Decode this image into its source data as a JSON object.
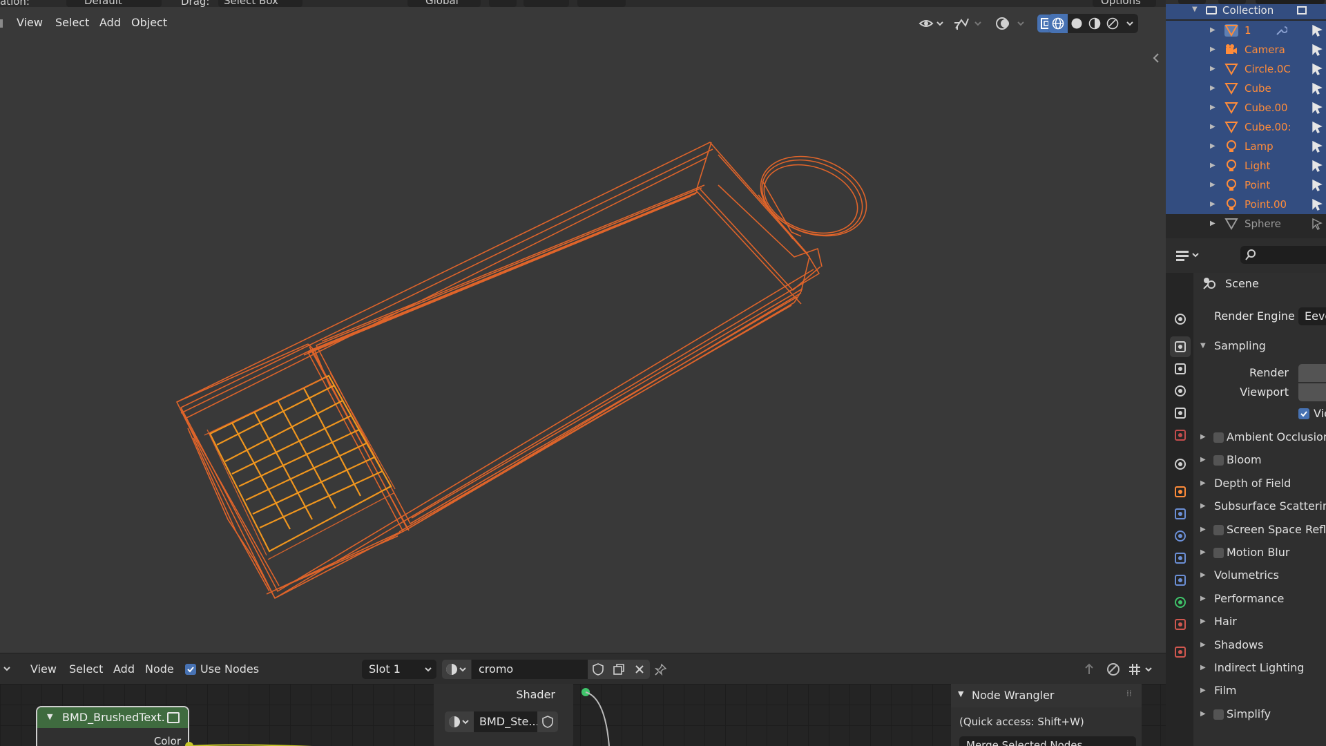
{
  "top_header": {
    "orientation_label": "ation:",
    "orientation_value": "Default",
    "drag_label": "Drag:",
    "drag_value": "Select Box",
    "transform_orientation": "Global",
    "options_label": "Options"
  },
  "viewport": {
    "menu": [
      "View",
      "Select",
      "Add",
      "Object"
    ],
    "wire_color": "#e8672a",
    "header_bg": "#393939"
  },
  "outliner": {
    "collection_label": "Collection",
    "items": [
      {
        "label": "1",
        "type": "mesh",
        "selected": true,
        "active": true
      },
      {
        "label": "Camera",
        "type": "camera",
        "selected": true
      },
      {
        "label": "Circle.0C",
        "type": "mesh",
        "selected": true
      },
      {
        "label": "Cube",
        "type": "mesh",
        "selected": true
      },
      {
        "label": "Cube.00",
        "type": "mesh",
        "selected": true
      },
      {
        "label": "Cube.00:",
        "type": "mesh",
        "selected": true
      },
      {
        "label": "Lamp",
        "type": "light",
        "selected": true
      },
      {
        "label": "Light",
        "type": "light",
        "selected": true
      },
      {
        "label": "Point",
        "type": "light",
        "selected": true
      },
      {
        "label": "Point.00",
        "type": "light",
        "selected": true
      },
      {
        "label": "Sphere",
        "type": "mesh",
        "selected": false
      }
    ],
    "selection_color": "#334d80",
    "selected_text_color": "#ff8c3a"
  },
  "properties": {
    "scene_label": "Scene",
    "render_engine_label": "Render Engine",
    "render_engine_value": "Eeve",
    "sampling": {
      "label": "Sampling",
      "render_label": "Render",
      "viewport_label": "Viewport",
      "viewport_denoise_label": "Vie"
    },
    "panels": [
      {
        "label": "Ambient Occlusion",
        "checkbox": true
      },
      {
        "label": "Bloom",
        "checkbox": true
      },
      {
        "label": "Depth of Field",
        "checkbox": false
      },
      {
        "label": "Subsurface Scattering",
        "checkbox": false
      },
      {
        "label": "Screen Space Refle",
        "checkbox": true
      },
      {
        "label": "Motion Blur",
        "checkbox": true
      },
      {
        "label": "Volumetrics",
        "checkbox": false
      },
      {
        "label": "Performance",
        "checkbox": false
      },
      {
        "label": "Hair",
        "checkbox": false
      },
      {
        "label": "Shadows",
        "checkbox": false
      },
      {
        "label": "Indirect Lighting",
        "checkbox": false
      },
      {
        "label": "Film",
        "checkbox": false
      },
      {
        "label": "Simplify",
        "checkbox": true
      }
    ]
  },
  "node_editor": {
    "menu": [
      "View",
      "Select",
      "Add",
      "Node"
    ],
    "use_nodes_label": "Use Nodes",
    "use_nodes_checked": true,
    "slot_value": "Slot 1",
    "material_name": "cromo",
    "node1_title": "BMD_BrushedText...",
    "node1_socket": "Color",
    "output_socket": "Shader",
    "node_material_name": "BMD_Ste...",
    "node_wrangler_title": "Node Wrangler",
    "node_wrangler_hint": "(Quick access: Shift+W)",
    "node_wrangler_dropdown": "Merge Selected Nodes"
  }
}
